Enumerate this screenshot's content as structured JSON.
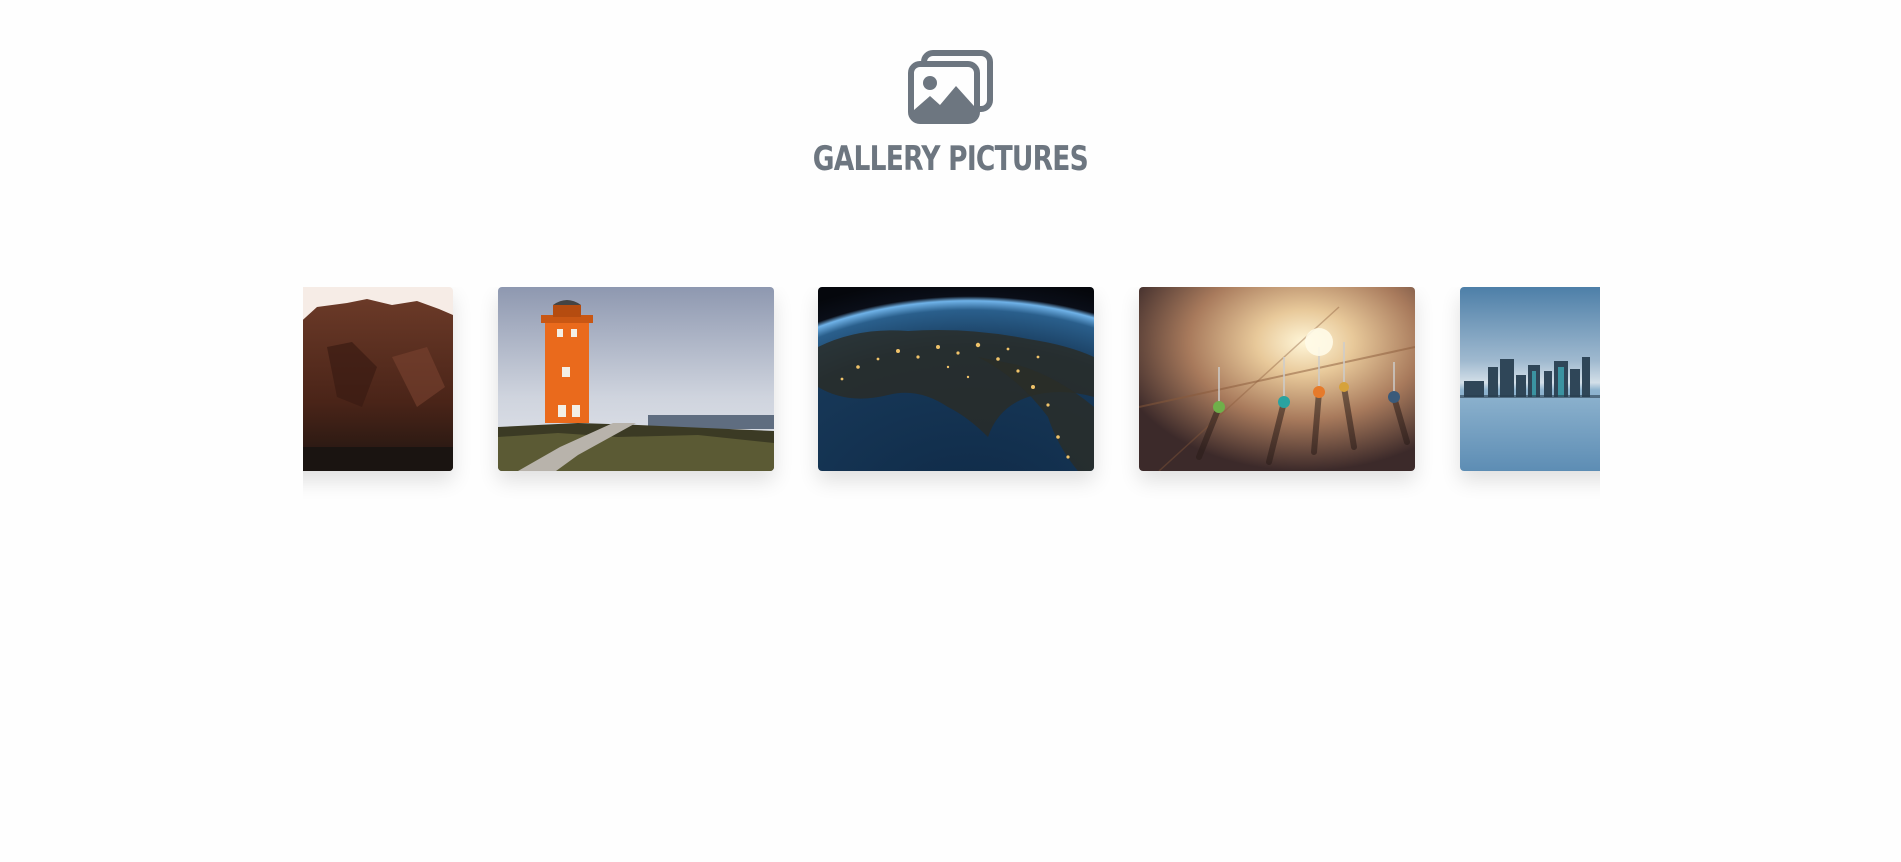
{
  "header": {
    "icon": "images-icon",
    "icon_color": "#6d7680",
    "title": "GALLERY PICTURES"
  },
  "carousel": {
    "slides": [
      {
        "name": "slide-rock-cliff",
        "subject": "rocky cliff"
      },
      {
        "name": "slide-lighthouse",
        "subject": "orange lighthouse"
      },
      {
        "name": "slide-earth-night",
        "subject": "earth from space at night"
      },
      {
        "name": "slide-map-pins",
        "subject": "map with push pins"
      },
      {
        "name": "slide-city-skyline",
        "subject": "city skyline over water"
      }
    ]
  }
}
